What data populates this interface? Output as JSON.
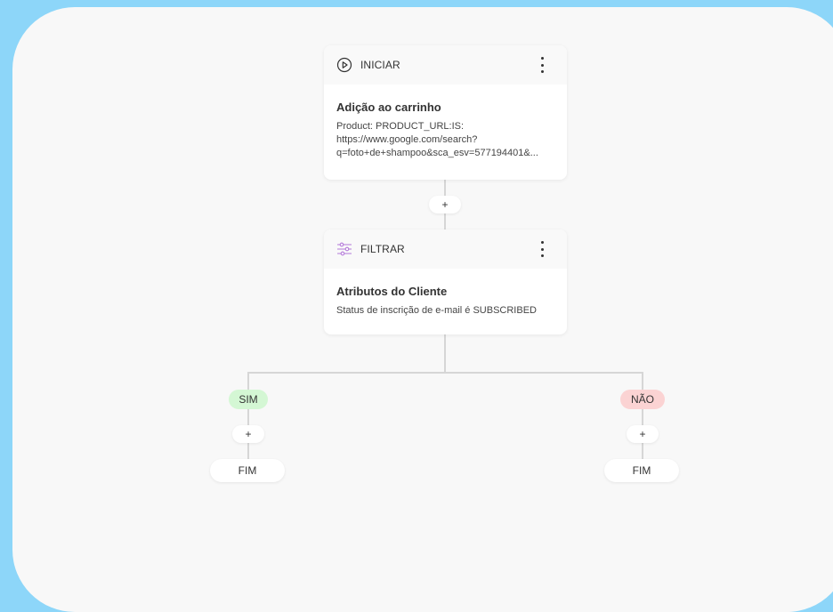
{
  "colors": {
    "background": "#8dd6f9",
    "canvas": "#f8f8f8",
    "yes_badge": "#d4f7d4",
    "no_badge": "#fbd3d3",
    "filter_icon": "#b479d9"
  },
  "start_node": {
    "icon": "play-circle-icon",
    "header_label": "INICIAR",
    "title": "Adição ao carrinho",
    "lines": [
      "Product: PRODUCT_URL:IS:",
      "https://www.google.com/search?",
      "q=foto+de+shampoo&sca_esv=577194401&..."
    ]
  },
  "add_step_label": "+",
  "filter_node": {
    "icon": "filter-sliders-icon",
    "header_label": "FILTRAR",
    "title": "Atributos do Cliente",
    "text": "Status de inscrição de e-mail é SUBSCRIBED"
  },
  "branches": {
    "yes_label": "SIM",
    "no_label": "NÃO",
    "yes_add_label": "+",
    "no_add_label": "+",
    "yes_end_label": "FIM",
    "no_end_label": "FIM"
  }
}
